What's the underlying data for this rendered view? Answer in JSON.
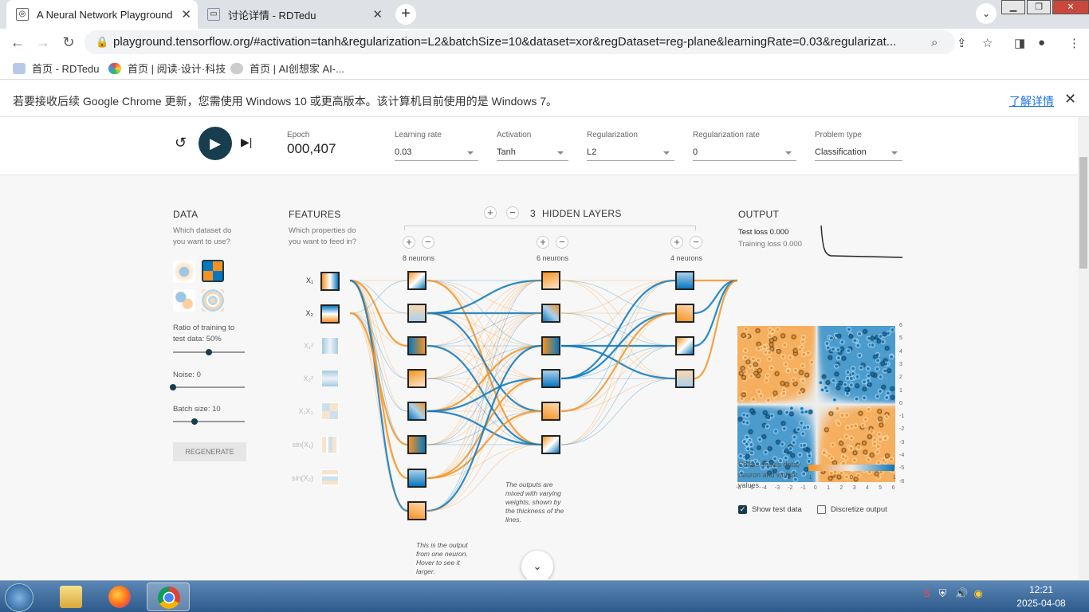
{
  "browser": {
    "tabs": [
      {
        "title": "A Neural Network Playground",
        "active": true
      },
      {
        "title": "讨论详情 - RDTedu",
        "active": false
      }
    ],
    "url": "playground.tensorflow.org/#activation=tanh&regularization=L2&batchSize=10&dataset=xor&regDataset=reg-plane&learningRate=0.03&regularizat...",
    "bookmarks": [
      "首页 - RDTedu",
      "首页 | 阅读·设计·科技",
      "首页 | AI创想家 AI-..."
    ],
    "infobar": {
      "message": "若要接收后续 Google Chrome 更新，您需使用 Windows 10 或更高版本。该计算机目前使用的是 Windows 7。",
      "link": "了解详情"
    }
  },
  "controls": {
    "epoch_label": "Epoch",
    "epoch": "000,407",
    "learning_rate": {
      "label": "Learning rate",
      "value": "0.03"
    },
    "activation": {
      "label": "Activation",
      "value": "Tanh"
    },
    "regularization": {
      "label": "Regularization",
      "value": "L2"
    },
    "regularization_rate": {
      "label": "Regularization rate",
      "value": "0"
    },
    "problem_type": {
      "label": "Problem type",
      "value": "Classification"
    }
  },
  "data_panel": {
    "title": "DATA",
    "subtitle": "Which dataset do you want to use?",
    "ratio_label": "Ratio of training to test data:  50%",
    "ratio": 0.5,
    "noise_label": "Noise:  0",
    "noise": 0,
    "batch_label": "Batch size:  10",
    "batch": 0.3,
    "regenerate": "REGENERATE"
  },
  "features": {
    "title": "FEATURES",
    "subtitle": "Which properties do you want to feed in?",
    "items": [
      {
        "label": "X₁",
        "on": true
      },
      {
        "label": "X₂",
        "on": true
      },
      {
        "label": "X₁²",
        "on": false
      },
      {
        "label": "X₂²",
        "on": false
      },
      {
        "label": "X₁X₂",
        "on": false
      },
      {
        "label": "sin(X₁)",
        "on": false
      },
      {
        "label": "sin(X₂)",
        "on": false
      }
    ]
  },
  "network": {
    "plus": "+",
    "minus": "−",
    "layers_count": "3",
    "layers_label": "HIDDEN LAYERS",
    "layer_labels": [
      "8 neurons",
      "6 neurons",
      "4 neurons"
    ],
    "note_output": "This is the output from one neuron. Hover to see it larger.",
    "note_weights": "The outputs are mixed with varying weights, shown by the thickness of the lines."
  },
  "output": {
    "title": "OUTPUT",
    "test_loss": "Test loss 0.000",
    "training_loss": "Training loss 0.000",
    "yticks": [
      "6",
      "5",
      "4",
      "3",
      "2",
      "1",
      "0",
      "-1",
      "-2",
      "-3",
      "-4",
      "-5",
      "-6"
    ],
    "xticks": [
      "-6",
      "-5",
      "-4",
      "-3",
      "-2",
      "-1",
      "0",
      "1",
      "2",
      "3",
      "4",
      "5",
      "6"
    ],
    "legend_text": "Colors shows data, neuron and weight values.",
    "legend_ticks": [
      "-1",
      "0",
      "1"
    ],
    "show_test": "Show test data",
    "discretize": "Discretize output",
    "colors": {
      "orange": "#f59322",
      "blue": "#0877bd"
    }
  },
  "taskbar": {
    "time": "12:21",
    "date": "2025-04-08"
  }
}
